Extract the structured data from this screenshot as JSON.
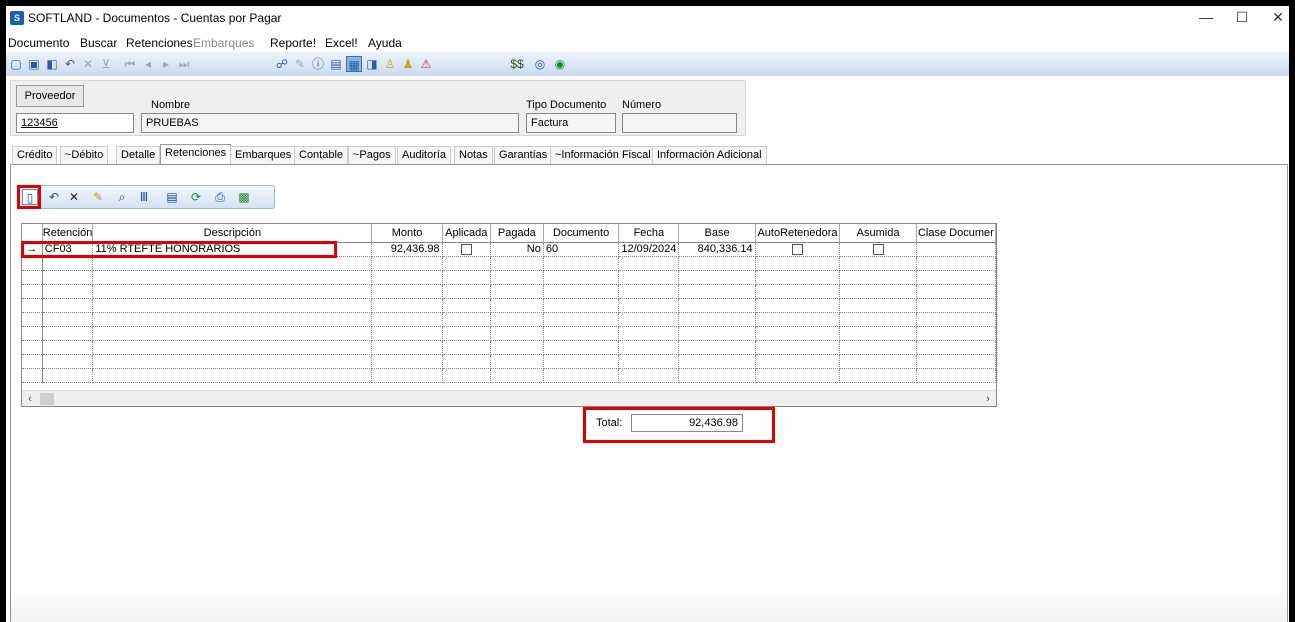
{
  "window": {
    "title": "SOFTLAND - Documentos - Cuentas por Pagar",
    "minimize": "—",
    "maximize": "☐",
    "close": "✕"
  },
  "menu": [
    {
      "label": "Documento",
      "enabled": true
    },
    {
      "label": "Buscar",
      "enabled": true
    },
    {
      "label": "Retenciones",
      "enabled": true
    },
    {
      "label": "Embarques",
      "enabled": false
    },
    {
      "label": "Reporte!",
      "enabled": true
    },
    {
      "label": "Excel!",
      "enabled": true
    },
    {
      "label": "Ayuda",
      "enabled": true
    }
  ],
  "header": {
    "proveedor_button": "Proveedor",
    "proveedor_value": "123456",
    "nombre_label": "Nombre",
    "nombre_value": "PRUEBAS",
    "tipo_documento_label": "Tipo Documento",
    "tipo_documento_value": "Factura",
    "numero_label": "Número",
    "numero_value": ""
  },
  "tabs": [
    {
      "label": "Crédito",
      "active": false
    },
    {
      "label": "~Débito",
      "active": false
    },
    {
      "label": "Detalle",
      "active": false
    },
    {
      "label": "Retenciones",
      "active": true
    },
    {
      "label": "Embarques",
      "active": false
    },
    {
      "label": "Contable",
      "active": false
    },
    {
      "label": "~Pagos",
      "active": false
    },
    {
      "label": "Auditoría",
      "active": false
    },
    {
      "label": "Notas",
      "active": false
    },
    {
      "label": "Garantías",
      "active": false
    },
    {
      "label": "~Información Fiscal",
      "active": false
    },
    {
      "label": "Información Adicional",
      "active": false
    }
  ],
  "grid": {
    "columns": [
      "Retención",
      "Descripción",
      "Monto",
      "Aplicada",
      "Pagada",
      "Documento",
      "Fecha",
      "Base",
      "AutoRetenedora",
      "Asumida",
      "Clase Documer"
    ],
    "rows": [
      {
        "retencion": "CF03",
        "descripcion": "11% RTEFTE HONORARIOS",
        "monto": "92,436.98",
        "aplicada": false,
        "pagada": "No",
        "documento": "60",
        "fecha": "12/09/2024",
        "base": "840,336.14",
        "autoretenedora": false,
        "asumida": false,
        "clase_documento": ""
      }
    ],
    "row_indicator": "→"
  },
  "totals": {
    "label": "Total:",
    "value": "92,436.98"
  },
  "colors": {
    "highlight": "#e00000",
    "toolbar_blue": "#c9dbf0"
  }
}
